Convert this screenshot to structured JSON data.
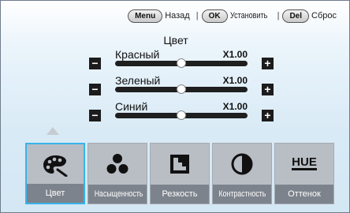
{
  "hints": [
    {
      "key": "Menu",
      "action": "Назад"
    },
    {
      "key": "OK",
      "action": "Установить"
    },
    {
      "key": "Del",
      "action": "Сброс"
    }
  ],
  "title": "Цвет",
  "sliders": [
    {
      "label": "Красный",
      "value_text": "X1.00",
      "level": 0.5
    },
    {
      "label": "Зеленый",
      "value_text": "X1.00",
      "level": 0.5
    },
    {
      "label": "Синий",
      "value_text": "X1.00",
      "level": 0.5
    }
  ],
  "buttons": {
    "minus": "−",
    "plus": "+"
  },
  "options": [
    {
      "label": "Цвет",
      "icon": "palette-icon",
      "selected": true
    },
    {
      "label": "Насыщенность",
      "icon": "three-dots-icon",
      "selected": false
    },
    {
      "label": "Резкость",
      "icon": "sharpness-icon",
      "selected": false
    },
    {
      "label": "Контрастность",
      "icon": "contrast-icon",
      "selected": false
    },
    {
      "label": "Оттенок",
      "icon": "hue-icon",
      "icon_text": "HUE",
      "selected": false
    }
  ],
  "colors": {
    "accent": "#39b3ea",
    "tile": "#b9bec5",
    "caption": "#7d838c"
  }
}
